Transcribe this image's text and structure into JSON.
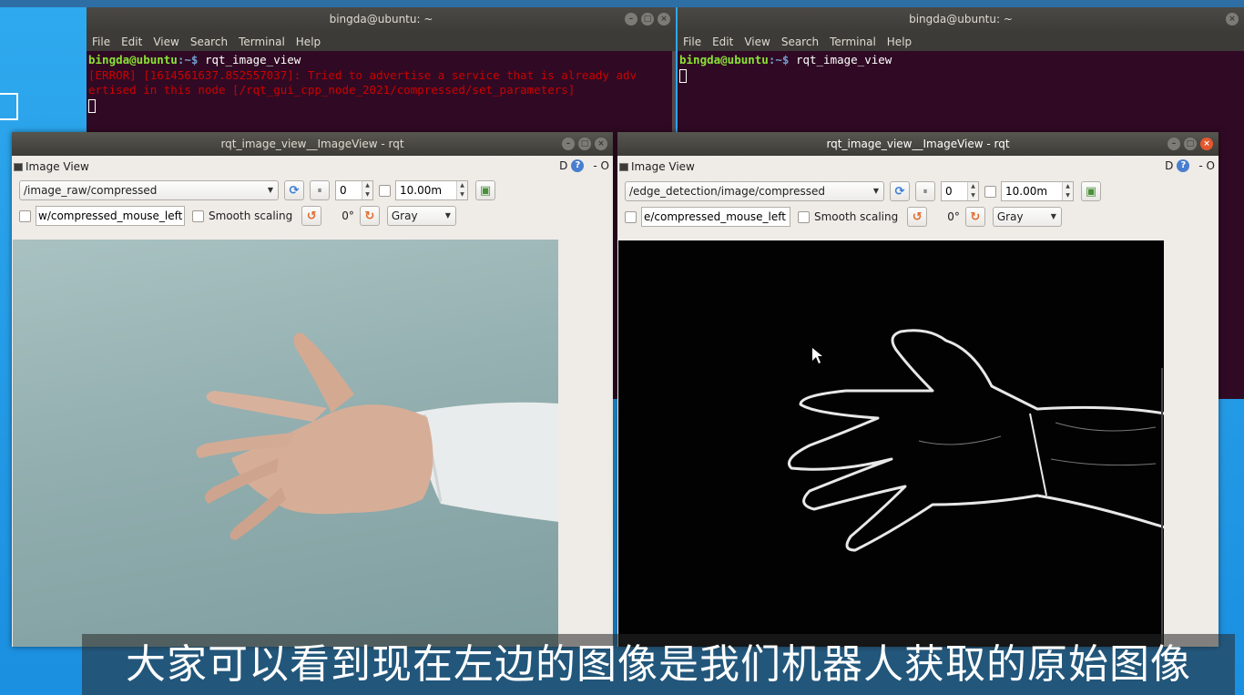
{
  "terminal_left": {
    "title": "bingda@ubuntu: ~",
    "menu": [
      "File",
      "Edit",
      "View",
      "Search",
      "Terminal",
      "Help"
    ],
    "prompt_user": "bingda@ubuntu",
    "prompt_path": ":~$",
    "command": " rqt_image_view",
    "error_line1": "[ERROR] [1614561637.852557037]: Tried to advertise a service that is already adv",
    "error_line2": "ertised in this node [/rqt_gui_cpp_node_2021/compressed/set_parameters]"
  },
  "terminal_right": {
    "title": "bingda@ubuntu: ~",
    "menu": [
      "File",
      "Edit",
      "View",
      "Search",
      "Terminal",
      "Help"
    ],
    "prompt_user": "bingda@ubuntu",
    "prompt_path": ":~$",
    "command": " rqt_image_view"
  },
  "rqt_left": {
    "title": "rqt_image_view__ImageView - rqt",
    "plugin_label": "Image View",
    "head_right": "D",
    "head_o": "- O",
    "topic": "/image_raw/compressed",
    "spin_value": "0",
    "rate": "10.00m",
    "mouse_topic": "w/compressed_mouse_left",
    "smooth_label": "Smooth scaling",
    "rotation": "0°",
    "color_mode": "Gray"
  },
  "rqt_right": {
    "title": "rqt_image_view__ImageView - rqt",
    "plugin_label": "Image View",
    "head_right": "D",
    "head_o": "- O",
    "topic": "/edge_detection/image/compressed",
    "spin_value": "0",
    "rate": "10.00m",
    "mouse_topic": "e/compressed_mouse_left",
    "smooth_label": "Smooth scaling",
    "rotation": "0°",
    "color_mode": "Gray"
  },
  "subtitle": "大家可以看到现在左边的图像是我们机器人获取的原始图像",
  "icons": {
    "refresh": "refresh-icon",
    "pause": "pause-icon",
    "rotate_left": "rotate-left-icon",
    "rotate_right": "rotate-right-icon",
    "save": "save-image-icon",
    "help": "help-icon"
  },
  "colors": {
    "terminal_bg": "#300a24",
    "error_text": "#cc0000",
    "prompt_user": "#8ae234",
    "prompt_path": "#729fcf",
    "close_button": "#e4572e"
  }
}
